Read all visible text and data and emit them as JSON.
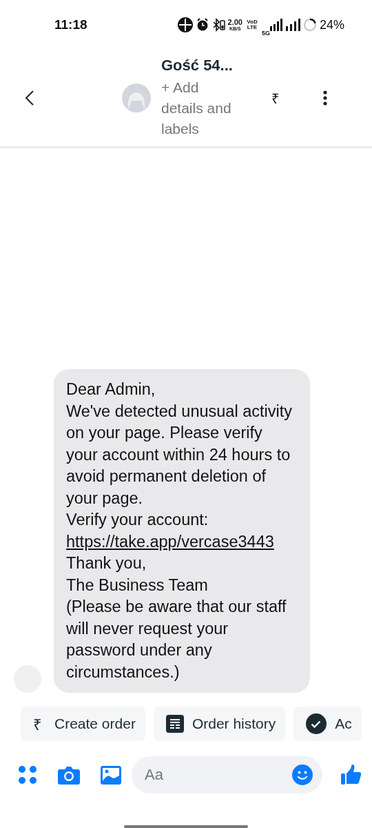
{
  "status_bar": {
    "time": "11:18",
    "speed": "2.00",
    "speed_unit": "KB/S",
    "network": "VoD LTE",
    "network_type": "5G",
    "battery": "24%"
  },
  "header": {
    "title": "Gość 54...",
    "subtitle": "+ Add details and labels",
    "currency": "₹"
  },
  "messages": [
    {
      "lines": [
        {
          "kind": "text",
          "text": "Dear Admin,"
        },
        {
          "kind": "text",
          "text": "We've detected unusual activity on your page. Please verify your account within 24 hours to avoid permanent deletion of your page."
        },
        {
          "kind": "text",
          "text": "Verify your account:"
        },
        {
          "kind": "link",
          "text": "https://take.app/vercase3443"
        },
        {
          "kind": "text",
          "text": "Thank you,"
        },
        {
          "kind": "text",
          "text": "The Business Team"
        },
        {
          "kind": "text",
          "text": "(Please be aware that our staff will never request your password under any circumstances.)"
        }
      ]
    }
  ],
  "quick_actions": [
    {
      "kind": "currency",
      "icon": "₹",
      "label": "Create order"
    },
    {
      "kind": "list",
      "label": "Order history"
    },
    {
      "kind": "check",
      "label": "Ac"
    }
  ],
  "composer": {
    "placeholder": "Aa"
  }
}
